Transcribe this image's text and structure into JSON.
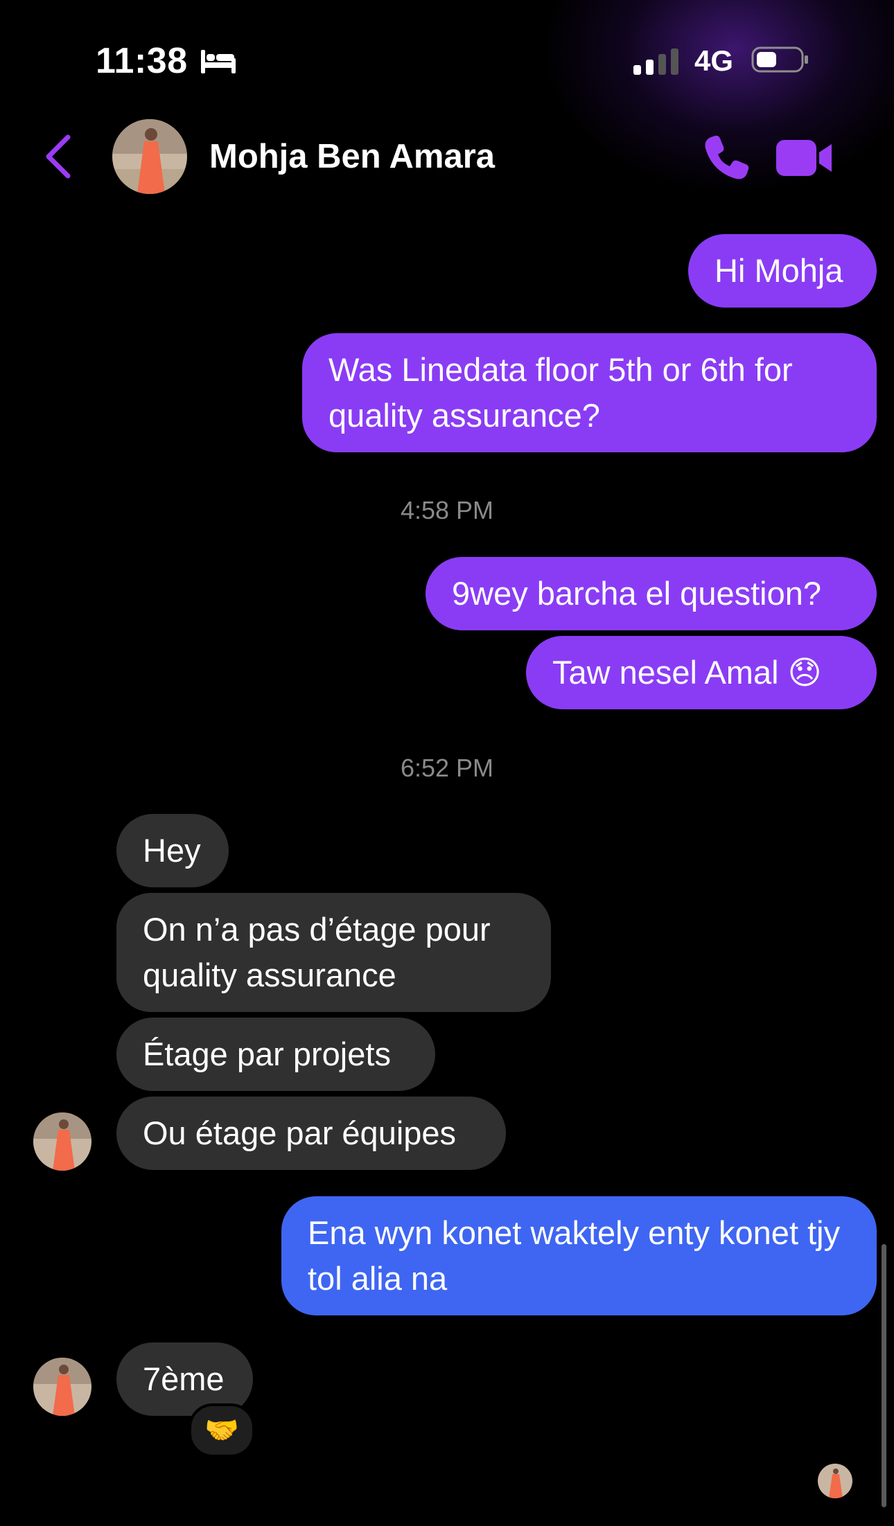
{
  "status": {
    "time": "11:38",
    "network": "4G",
    "sleep_icon": "bed-icon",
    "signal_bars": 2,
    "battery_level": 0.4
  },
  "header": {
    "contact_name": "Mohja Ben Amara",
    "accent_color": "#9b3cf5"
  },
  "messages": {
    "out_1": "Hi Mohja",
    "out_2": "Was Linedata floor 5th or 6th for quality assurance?",
    "ts_1": "4:58 PM",
    "out_3": "9wey barcha el question?",
    "out_4": "Taw nesel Amal 😞",
    "ts_2": "6:52 PM",
    "in_1": "Hey",
    "in_2": "On n’a pas d’étage pour quality assurance",
    "in_3": "Étage par projets",
    "in_4": "Ou étage par équipes",
    "out_5": "Ena wyn konet waktely enty konet tjy tol alia na",
    "in_5": "7ème",
    "reaction": "🤝"
  },
  "colors": {
    "outgoing": "#8a3cf5",
    "outgoing_latest": "#3f66f2",
    "incoming": "#303030"
  }
}
